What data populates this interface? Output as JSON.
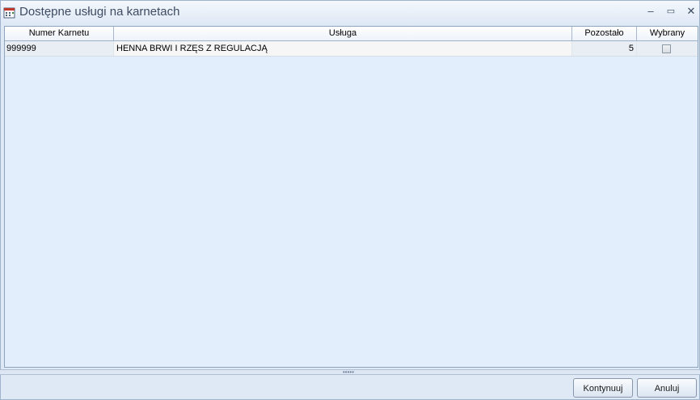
{
  "window": {
    "title": "Dostępne usługi na karnetach",
    "minimize_glyph": "–",
    "maximize_glyph": "▭",
    "close_glyph": "✕"
  },
  "grid": {
    "columns": [
      "Numer Karnetu",
      "Usługa",
      "Pozostało",
      "Wybrany"
    ],
    "rows": [
      {
        "card_number": "999999",
        "service": "HENNA BRWI I RZĘS Z REGULACJĄ",
        "remaining": "5",
        "selected": false
      }
    ]
  },
  "footer": {
    "continue_label": "Kontynuuj",
    "cancel_label": "Anuluj"
  },
  "icons": {
    "app": "calendar-grid-icon",
    "checkbox": "checkbox-unchecked-icon",
    "splitter": "grip-dots-icon"
  }
}
